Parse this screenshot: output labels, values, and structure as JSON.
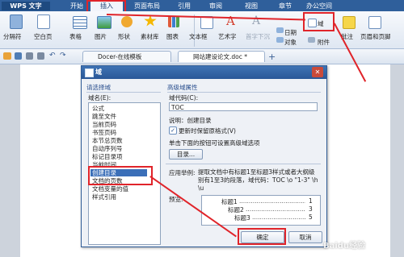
{
  "titlebar": {
    "app_name": "WPS 文字",
    "menus": [
      "开始",
      "插入",
      "页面布局",
      "引用",
      "审阅",
      "视图",
      "章节",
      "办公空间"
    ],
    "active_menu": "插入"
  },
  "ribbon": {
    "left_items": [
      "分隔符",
      "空白页",
      "表格",
      "图片",
      "形状",
      "素材库",
      "图表"
    ],
    "right_items": [
      "文本框",
      "艺术字",
      "首字下沉",
      "日期",
      "对象",
      "附件",
      "批注",
      "页眉和页脚"
    ],
    "field_button": "域"
  },
  "tabs": {
    "tab1": "Docer-在线模板",
    "tab2": "网站建设论文.doc *",
    "add": "+"
  },
  "dialog": {
    "title": "域",
    "left_group": "请选择域",
    "field_name_label": "域名(E):",
    "fields": [
      "公式",
      "跳至文件",
      "当前页码",
      "书签页码",
      "本节总页数",
      "自动序列号",
      "标记目录项",
      "当前时间",
      "创建目录",
      "文档的页数",
      "文档变量的值",
      "样式引用"
    ],
    "selected_field": "创建目录",
    "right_group": "高级域属性",
    "field_code_label": "域代码(C):",
    "field_code_value": "TOC",
    "description": "说明：创建目录",
    "keep_format_label": "更新时保留原格式(V)",
    "hint": "单击下面的按钮可设置高级域选项",
    "toc_button": "目录...",
    "example_label": "应用举例:",
    "example_text": "提取文档中有标题1至标题3样式或者大纲级别有1至3的段落，域代码：TOC \\o \"1-3\" \\h \\u",
    "preview_label": "预览:",
    "preview_lines": [
      {
        "text": "标题1",
        "page": "1"
      },
      {
        "text": "标题2",
        "page": "3"
      },
      {
        "text": "标题3",
        "page": "5"
      }
    ],
    "ok": "确定",
    "cancel": "取消"
  },
  "watermark": "Baidu经验"
}
